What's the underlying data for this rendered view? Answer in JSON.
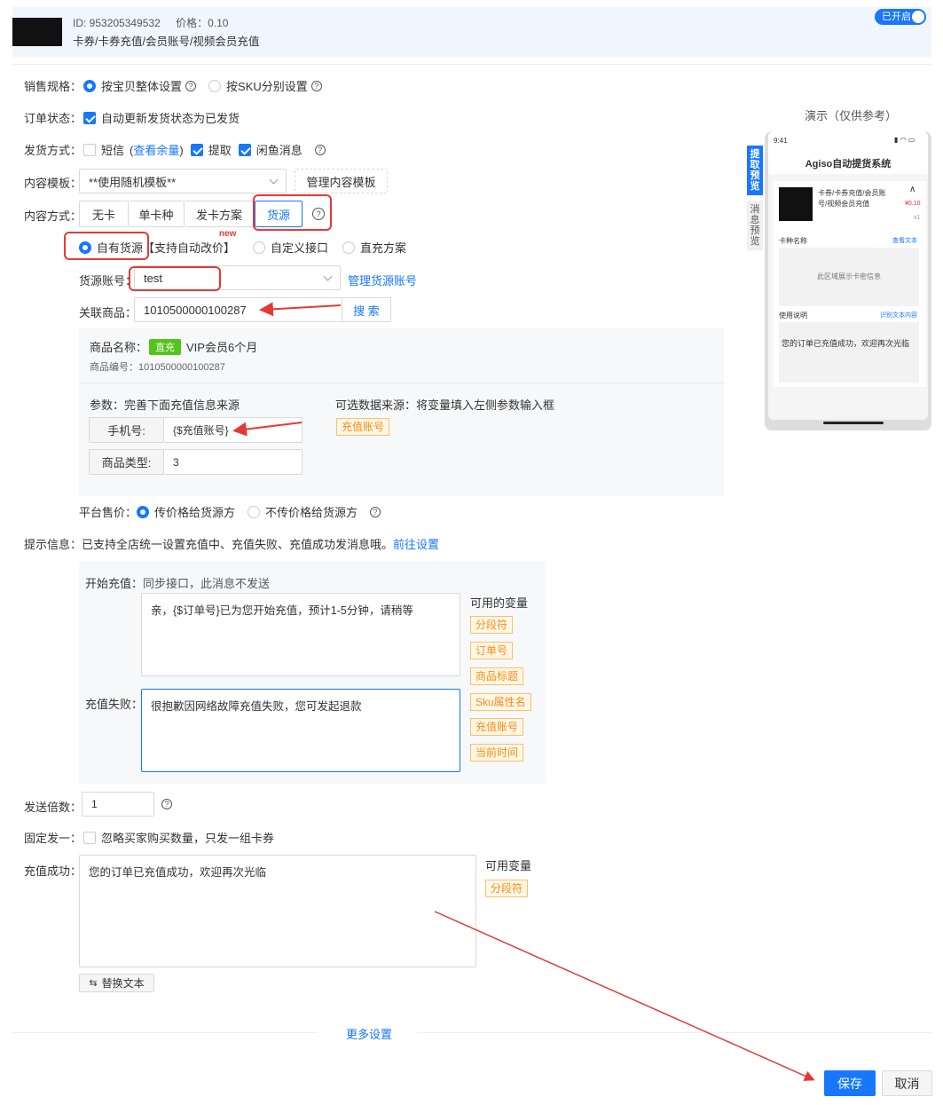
{
  "header": {
    "id_text": "ID: 953205349532",
    "price_text": "价格：0.10",
    "category": "卡券/卡券充值/会员账号/视频会员充值",
    "toggle_label": "已开启"
  },
  "sale_spec": {
    "label": "销售规格：",
    "options": [
      "按宝贝整体设置",
      "按SKU分别设置"
    ]
  },
  "order_status": {
    "label": "订单状态：",
    "checkbox_label": "自动更新发货状态为已发货"
  },
  "delivery": {
    "label": "发货方式：",
    "sms": "短信",
    "sms_link_prefix": "(",
    "sms_link": "查看余量",
    "sms_link_suffix": ")",
    "pickup": "提取",
    "xianyu": "闲鱼消息"
  },
  "template": {
    "label": "内容模板：",
    "value": "**使用随机模板**",
    "manage_button": "管理内容模板"
  },
  "content_mode": {
    "label": "内容方式：",
    "tabs": [
      "无卡",
      "单卡种",
      "发卡方案",
      "货源"
    ]
  },
  "source_type": {
    "own": "自有货源",
    "own_note": "【支持自动改价】",
    "new_badge": "new",
    "custom": "自定义接口",
    "direct": "直充方案"
  },
  "source_account": {
    "label": "货源账号：",
    "value": "test",
    "manage_link": "管理货源账号"
  },
  "linked_product": {
    "label": "关联商品：",
    "value": "1010500000100287",
    "search_button": "搜 索"
  },
  "product_info": {
    "name_label": "商品名称：",
    "badge": "直充",
    "name": "VIP会员6个月",
    "code_text": "商品编号：1010500000100287",
    "params_label": "参数：完善下面充值信息来源",
    "optional_source": "可选数据来源：将变量填入左侧参数输入框",
    "phone_label": "手机号:",
    "phone_value": "{$充值账号}",
    "type_label": "商品类型:",
    "type_value": "3",
    "var_tag": "充值账号"
  },
  "platform_price": {
    "label": "平台售价：",
    "options": [
      "传价格给货源方",
      "不传价格给货源方"
    ]
  },
  "tips": {
    "label": "提示信息：",
    "text": "已支持全店统一设置充值中、充值失败、充值成功发消息哦。",
    "link": "前往设置",
    "start_label": "开始充值：",
    "start_note": "同步接口，此消息不发送",
    "start_text": "亲，{$订单号}已为您开始充值，预计1-5分钟，请稍等",
    "fail_label": "充值失败：",
    "fail_text": "很抱歉因网络故障充值失败，您可发起退款",
    "vars_title": "可用的变量",
    "vars": [
      "分段符",
      "订单号",
      "商品标题",
      "Sku属性名",
      "充值账号",
      "当前时间"
    ]
  },
  "send_multiple": {
    "label": "发送倍数：",
    "value": "1"
  },
  "fixed_one": {
    "label": "固定发一：",
    "checkbox_label": "忽略买家购买数量，只发一组卡券"
  },
  "success": {
    "label": "充值成功：",
    "text": "您的订单已充值成功，欢迎再次光临",
    "vars_title": "可用变量",
    "var": "分段符",
    "replace_button": "替换文本"
  },
  "more_settings": "更多设置",
  "footer": {
    "save": "保存",
    "cancel": "取消"
  },
  "preview": {
    "title": "演示（仅供参考）",
    "time": "9:41",
    "app_title": "Agiso自动提货系统",
    "tab_pickup": "提取预览",
    "tab_msg": "消息预览",
    "product_title": "卡券/卡券充值/会员账号/视频会员充值",
    "price": "¥0.10",
    "qty": "x1",
    "card_label": "卡种名称",
    "view_text": "查看文本",
    "card_placeholder": "此区域展示卡密信息",
    "usage_label": "使用说明",
    "recognize_text": "识别文本内容",
    "usage_text": "您的订单已充值成功，欢迎再次光临"
  },
  "colors": {
    "primary": "#1677ff",
    "warning_tag": "#fa8c16",
    "badge_green": "#52c41a",
    "annotation_red": "#e53935"
  }
}
